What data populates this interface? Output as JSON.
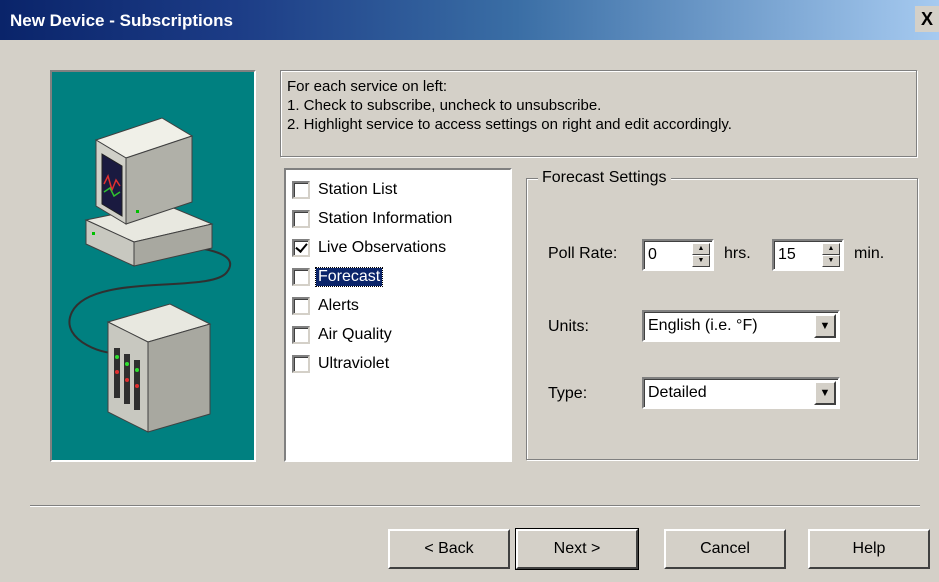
{
  "window": {
    "title": "New Device - Subscriptions",
    "close_glyph": "X"
  },
  "instructions": {
    "line1": "For each service on left:",
    "line2": "1. Check to subscribe, uncheck to unsubscribe.",
    "line3": "2. Highlight service to access settings on right and edit accordingly."
  },
  "services": [
    {
      "label": "Station List",
      "checked": false,
      "selected": false
    },
    {
      "label": "Station Information",
      "checked": false,
      "selected": false
    },
    {
      "label": "Live Observations",
      "checked": true,
      "selected": false
    },
    {
      "label": "Forecast",
      "checked": false,
      "selected": true
    },
    {
      "label": "Alerts",
      "checked": false,
      "selected": false
    },
    {
      "label": "Air Quality",
      "checked": false,
      "selected": false
    },
    {
      "label": "Ultraviolet",
      "checked": false,
      "selected": false
    }
  ],
  "forecast_settings": {
    "title": "Forecast Settings",
    "poll_rate_label": "Poll Rate:",
    "hours_value": "0",
    "hours_unit": "hrs.",
    "minutes_value": "15",
    "minutes_unit": "min.",
    "units_label": "Units:",
    "units_value": "English  (i.e. °F)",
    "type_label": "Type:",
    "type_value": "Detailed"
  },
  "buttons": {
    "back": "< Back",
    "next": "Next >",
    "cancel": "Cancel",
    "help": "Help"
  },
  "icons": {
    "computer": "computer-icon",
    "server": "server-rack-icon",
    "spin_up": "▲",
    "spin_down": "▼",
    "dropdown": "▼"
  },
  "colors": {
    "dialog_bg": "#d4d0c8",
    "title_bar": "#0a246a",
    "illustration_bg": "#008080",
    "selection": "#0a246a"
  }
}
